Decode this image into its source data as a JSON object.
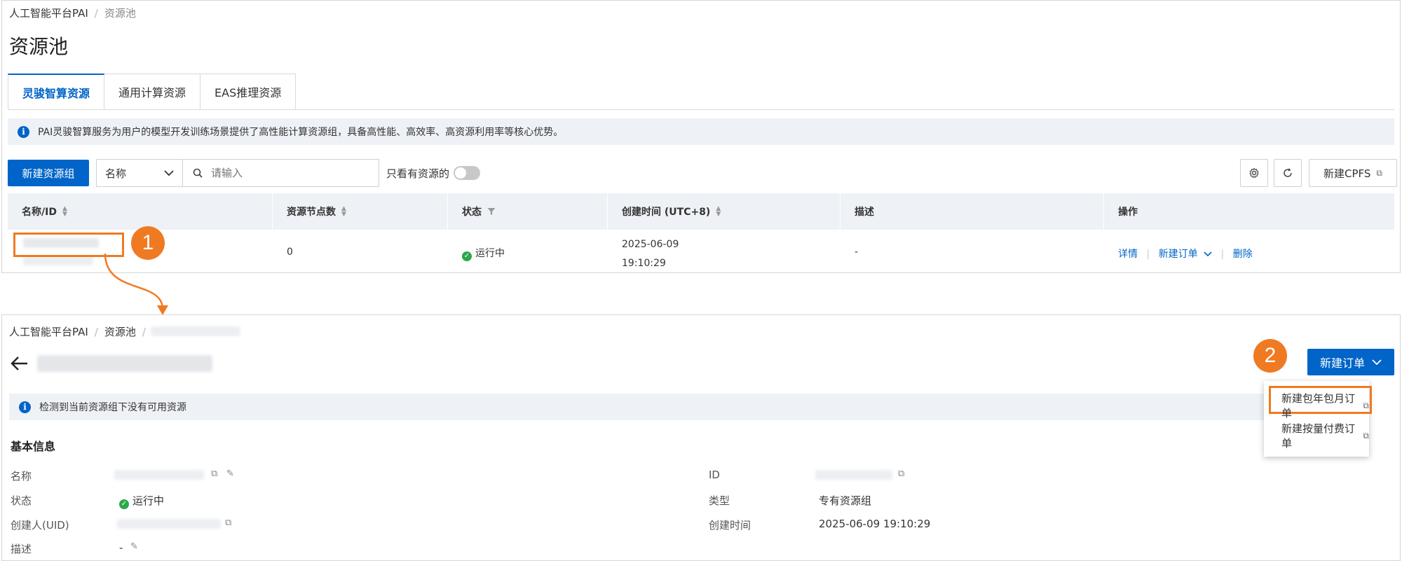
{
  "top": {
    "breadcrumb": {
      "root": "人工智能平台PAI",
      "sep": "/",
      "current": "资源池"
    },
    "title": "资源池",
    "tabs": [
      {
        "label": "灵骏智算资源"
      },
      {
        "label": "通用计算资源"
      },
      {
        "label": "EAS推理资源"
      }
    ],
    "notice": "PAI灵骏智算服务为用户的模型开发训练场景提供了高性能计算资源组，具备高性能、高效率、高资源利用率等核心优势。",
    "toolbar": {
      "create_button": "新建资源组",
      "filter_select": "名称",
      "search_placeholder": "请输入",
      "only_mine_label": "只看有资源的",
      "new_cpfs_button": "新建CPFS"
    },
    "table": {
      "columns": [
        "名称/ID",
        "资源节点数",
        "状态",
        "创建时间 (UTC+8)",
        "描述",
        "操作"
      ],
      "row": {
        "nodes": "0",
        "status": "运行中",
        "created_date": "2025-06-09",
        "created_time": "19:10:29",
        "desc": "-",
        "actions": [
          "详情",
          "新建订单",
          "删除"
        ]
      }
    },
    "step_badge": "1"
  },
  "bottom": {
    "breadcrumb": {
      "root": "人工智能平台PAI",
      "sep1": "/",
      "mid": "资源池",
      "sep2": "/"
    },
    "new_order_button": "新建订单",
    "step_badge": "2",
    "dropdown": {
      "items": [
        {
          "label": "新建包年包月订单"
        },
        {
          "label": "新建按量付费订单"
        }
      ]
    },
    "notice": "检测到当前资源组下没有可用资源",
    "section_title": "基本信息",
    "fields_left": [
      {
        "label": "名称"
      },
      {
        "label": "状态",
        "value": "运行中"
      },
      {
        "label": "创建人(UID)"
      },
      {
        "label": "描述",
        "value": "-"
      }
    ],
    "fields_right": [
      {
        "label": "ID"
      },
      {
        "label": "类型",
        "value": "专有资源组"
      },
      {
        "label": "创建时间",
        "value": "2025-06-09 19:10:29"
      }
    ]
  },
  "colors": {
    "primary": "#0064c8",
    "accent": "#f07a22",
    "success": "#2aa84a",
    "notice_bg": "#eef1f6"
  }
}
